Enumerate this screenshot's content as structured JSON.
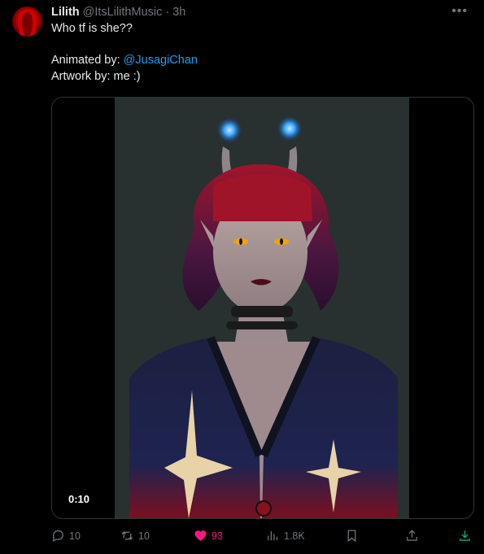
{
  "author": {
    "display_name": "Lilith",
    "handle": "@ItsLilithMusic",
    "separator": "·",
    "time": "3h"
  },
  "tweet": {
    "line1": "Who tf is she??",
    "animated_by_label": "Animated by: ",
    "animated_by_link": "@JusagiChan",
    "artwork_line": "Artwork by: me :)"
  },
  "media": {
    "duration": "0:10"
  },
  "actions": {
    "replies": "10",
    "retweets": "10",
    "likes": "93",
    "views": "1.8K"
  },
  "colors": {
    "link": "#1d9bf0",
    "like": "#f91880",
    "download": "#00ba7c",
    "muted": "#71767b"
  }
}
